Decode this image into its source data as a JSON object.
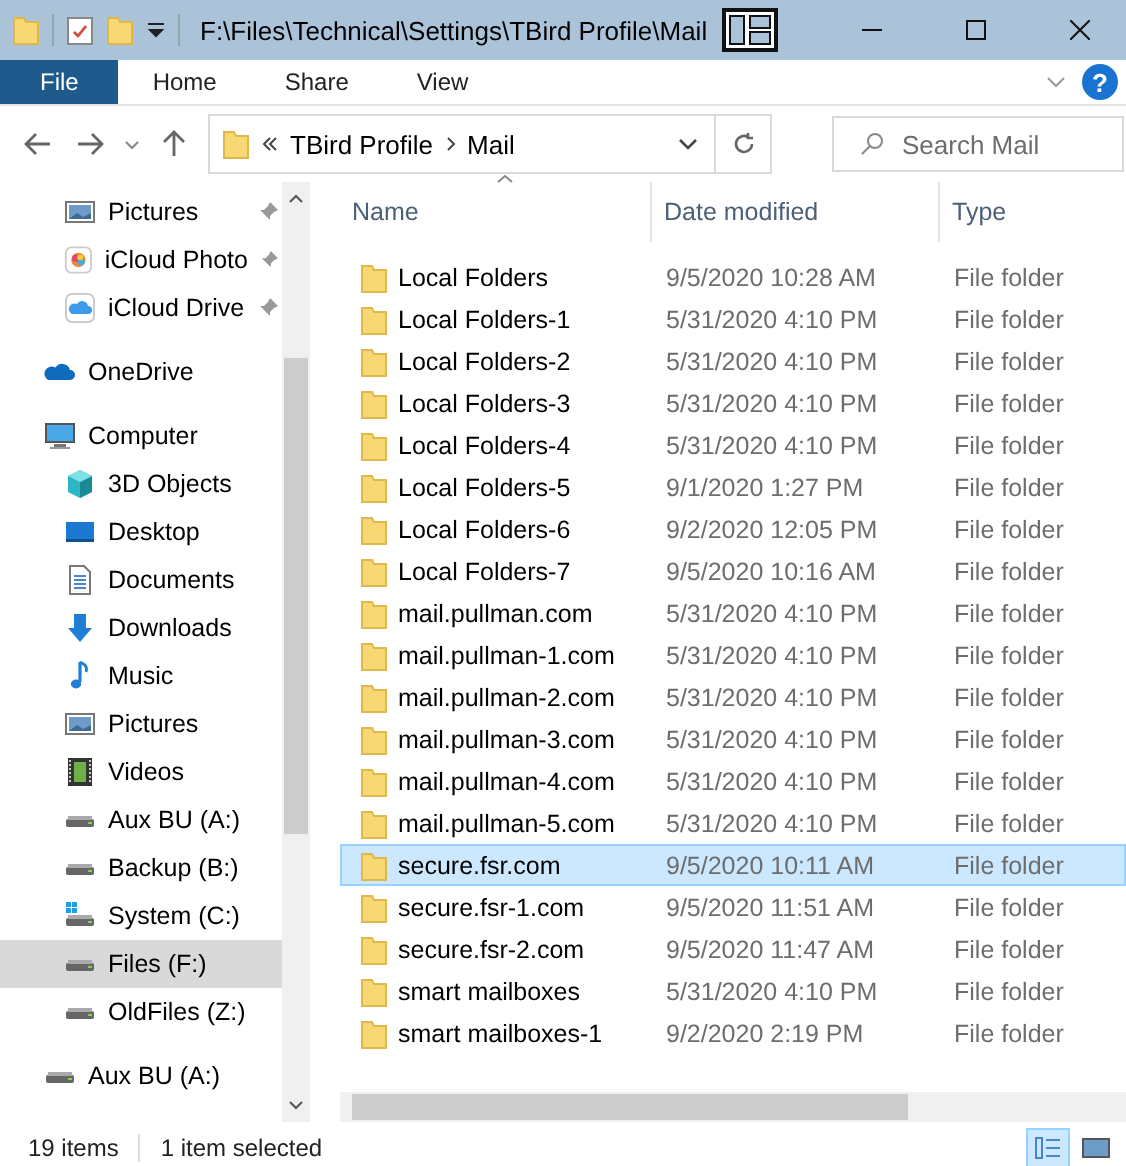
{
  "window": {
    "title": "F:\\Files\\Technical\\Settings\\TBird Profile\\Mail"
  },
  "ribbon": {
    "tabs": [
      {
        "label": "File",
        "selected": true
      },
      {
        "label": "Home",
        "selected": false
      },
      {
        "label": "Share",
        "selected": false
      },
      {
        "label": "View",
        "selected": false
      }
    ],
    "help": "?"
  },
  "address": {
    "crumbs": [
      "TBird Profile",
      "Mail"
    ],
    "search": {
      "placeholder": "Search Mail"
    }
  },
  "sidebar": {
    "pinned": [
      {
        "label": "Pictures",
        "kind": "pictures"
      },
      {
        "label": "iCloud Photo",
        "kind": "photos"
      },
      {
        "label": "iCloud Drive",
        "kind": "cloud"
      }
    ],
    "roots": [
      {
        "label": "OneDrive",
        "kind": "onedrive",
        "selected": false
      },
      {
        "label": "Computer",
        "kind": "computer",
        "selected": false,
        "children": [
          {
            "label": "3D Objects",
            "kind": "cube",
            "selected": false
          },
          {
            "label": "Desktop",
            "kind": "desktop",
            "selected": false
          },
          {
            "label": "Documents",
            "kind": "document",
            "selected": false
          },
          {
            "label": "Downloads",
            "kind": "download",
            "selected": false
          },
          {
            "label": "Music",
            "kind": "music",
            "selected": false
          },
          {
            "label": "Pictures",
            "kind": "pictures",
            "selected": false
          },
          {
            "label": "Videos",
            "kind": "video",
            "selected": false
          },
          {
            "label": "Aux BU (A:)",
            "kind": "drive",
            "selected": false
          },
          {
            "label": "Backup (B:)",
            "kind": "drive",
            "selected": false
          },
          {
            "label": "System (C:)",
            "kind": "sysdrive",
            "selected": false
          },
          {
            "label": "Files (F:)",
            "kind": "drive",
            "selected": true
          },
          {
            "label": "OldFiles (Z:)",
            "kind": "drive",
            "selected": false
          }
        ]
      },
      {
        "label": "Aux BU (A:)",
        "kind": "drive",
        "selected": false
      }
    ]
  },
  "table": {
    "columns": [
      "Name",
      "Date modified",
      "Type"
    ],
    "rows": [
      {
        "name": "Local Folders",
        "date": "9/5/2020 10:28 AM",
        "type": "File folder",
        "selected": false
      },
      {
        "name": "Local Folders-1",
        "date": "5/31/2020 4:10 PM",
        "type": "File folder",
        "selected": false
      },
      {
        "name": "Local Folders-2",
        "date": "5/31/2020 4:10 PM",
        "type": "File folder",
        "selected": false
      },
      {
        "name": "Local Folders-3",
        "date": "5/31/2020 4:10 PM",
        "type": "File folder",
        "selected": false
      },
      {
        "name": "Local Folders-4",
        "date": "5/31/2020 4:10 PM",
        "type": "File folder",
        "selected": false
      },
      {
        "name": "Local Folders-5",
        "date": "9/1/2020 1:27 PM",
        "type": "File folder",
        "selected": false
      },
      {
        "name": "Local Folders-6",
        "date": "9/2/2020 12:05 PM",
        "type": "File folder",
        "selected": false
      },
      {
        "name": "Local Folders-7",
        "date": "9/5/2020 10:16 AM",
        "type": "File folder",
        "selected": false
      },
      {
        "name": "mail.pullman.com",
        "date": "5/31/2020 4:10 PM",
        "type": "File folder",
        "selected": false
      },
      {
        "name": "mail.pullman-1.com",
        "date": "5/31/2020 4:10 PM",
        "type": "File folder",
        "selected": false
      },
      {
        "name": "mail.pullman-2.com",
        "date": "5/31/2020 4:10 PM",
        "type": "File folder",
        "selected": false
      },
      {
        "name": "mail.pullman-3.com",
        "date": "5/31/2020 4:10 PM",
        "type": "File folder",
        "selected": false
      },
      {
        "name": "mail.pullman-4.com",
        "date": "5/31/2020 4:10 PM",
        "type": "File folder",
        "selected": false
      },
      {
        "name": "mail.pullman-5.com",
        "date": "5/31/2020 4:10 PM",
        "type": "File folder",
        "selected": false
      },
      {
        "name": "secure.fsr.com",
        "date": "9/5/2020 10:11 AM",
        "type": "File folder",
        "selected": true
      },
      {
        "name": "secure.fsr-1.com",
        "date": "9/5/2020 11:51 AM",
        "type": "File folder",
        "selected": false
      },
      {
        "name": "secure.fsr-2.com",
        "date": "9/5/2020 11:47 AM",
        "type": "File folder",
        "selected": false
      },
      {
        "name": "smart mailboxes",
        "date": "5/31/2020 4:10 PM",
        "type": "File folder",
        "selected": false
      },
      {
        "name": "smart mailboxes-1",
        "date": "9/2/2020 2:19 PM",
        "type": "File folder",
        "selected": false
      }
    ]
  },
  "status_bar": {
    "items": [
      "19 items",
      "1 item selected"
    ],
    "views": [
      {
        "kind": "details",
        "selected": true
      },
      {
        "kind": "large",
        "selected": false
      }
    ]
  }
}
